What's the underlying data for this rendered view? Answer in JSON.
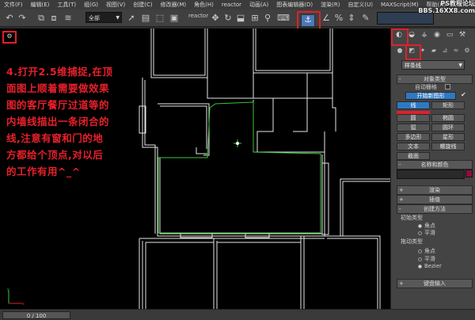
{
  "menubar": {
    "items": [
      "文件(F)",
      "编辑(E)",
      "工具(T)",
      "组(G)",
      "视图(V)",
      "创建(C)",
      "修改器(M)",
      "角色(H)",
      "reactor",
      "动画(A)",
      "图表编辑器(D)",
      "渲染(R)",
      "自定义(U)",
      "MAXScript(M)",
      "帮助(H)"
    ]
  },
  "toolbar": {
    "selection_filter": "全部",
    "reactor_label": "reactor",
    "undo_icon": "undo-icon",
    "redo_icon": "redo-icon",
    "snap_icon": "snap-2.5d-icon"
  },
  "watermark": {
    "line1": "PS教程论坛",
    "line2": "BBS.16XX8.com"
  },
  "viewport": {
    "corner_icon": "viewport-menu-icon",
    "instruction_lines": [
      "4.打开2.5维捕捉,在顶",
      "面图上顺着需要做效果",
      "图的客厅餐厅过道等的",
      "内墙线描出一条闭合的",
      "线,注意有窗和门的地",
      "方都给个顶点,对以后",
      "的工作有用^_^"
    ]
  },
  "command_panel": {
    "tabs": [
      "create-tab-icon",
      "modify-tab-icon",
      "hierarchy-tab-icon",
      "motion-tab-icon",
      "display-tab-icon",
      "utilities-tab-icon"
    ],
    "subtabs": [
      "geometry-icon",
      "shapes-icon",
      "lights-icon",
      "cameras-icon",
      "helpers-icon",
      "spacewarps-icon",
      "systems-icon"
    ],
    "category_dropdown": "样条线",
    "object_type": {
      "title": "对象类型",
      "auto_grid": "自动栅格",
      "start_new_shape": "开始新图形",
      "start_new_shape_checked": true,
      "buttons": [
        {
          "label": "线",
          "selected": true
        },
        {
          "label": "矩形",
          "selected": false
        },
        {
          "label": "圆",
          "selected": false
        },
        {
          "label": "椭圆",
          "selected": false
        },
        {
          "label": "弧",
          "selected": false
        },
        {
          "label": "圆环",
          "selected": false
        },
        {
          "label": "多边形",
          "selected": false
        },
        {
          "label": "星形",
          "selected": false
        },
        {
          "label": "文本",
          "selected": false
        },
        {
          "label": "螺旋线",
          "selected": false
        },
        {
          "label": "截面",
          "selected": false
        }
      ]
    },
    "name_color": {
      "title": "名称和颜色",
      "color": "#8a1040"
    },
    "rollouts": {
      "render": "渲染",
      "interpolation": "插值",
      "creation_method": "创建方法",
      "keyboard_entry": "键盘输入"
    },
    "initial_type": {
      "title": "初始类型",
      "options": [
        {
          "label": "角点",
          "on": true
        },
        {
          "label": "平滑",
          "on": false
        }
      ]
    },
    "drag_type": {
      "title": "拖动类型",
      "options": [
        {
          "label": "角点",
          "on": false
        },
        {
          "label": "平滑",
          "on": false
        },
        {
          "label": "Bezier",
          "on": true
        }
      ]
    }
  },
  "statusbar": {
    "time_slider": "0 / 100"
  },
  "colors": {
    "highlight_red": "#e0202a",
    "active_blue": "#2f78c4",
    "wall_white": "#e6e6e6",
    "spline_green": "#3cc43c"
  }
}
